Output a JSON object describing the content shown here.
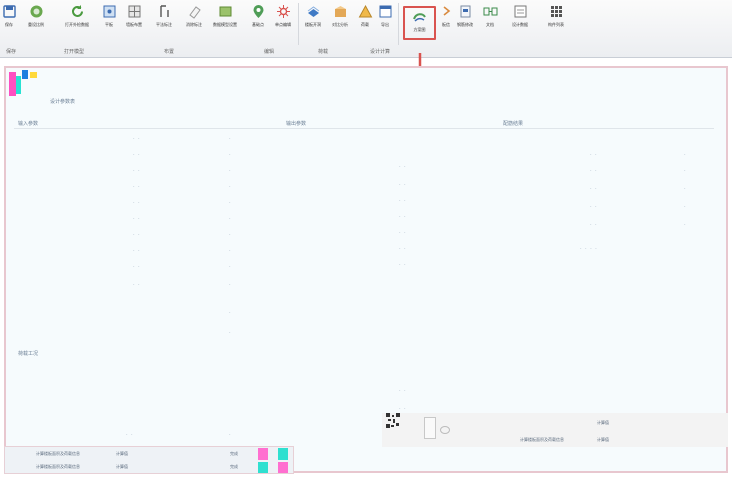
{
  "toolbar": {
    "buttons": [
      {
        "label": "保存",
        "icon": "save-icon"
      },
      {
        "label": "重设比例",
        "icon": "reset-icon"
      },
      {
        "label": "打开外检数据",
        "icon": "refresh-open-icon"
      },
      {
        "label": "平板",
        "icon": "panel-icon"
      },
      {
        "label": "墙板布置",
        "icon": "wall-panel-icon"
      },
      {
        "label": "平法标注",
        "icon": "annotation-icon"
      },
      {
        "label": "消除标注",
        "icon": "erase-icon"
      },
      {
        "label": "数据模型设置",
        "icon": "model-settings-icon"
      },
      {
        "label": "基础点",
        "icon": "map-pin-icon"
      },
      {
        "label": "单点编辑",
        "icon": "star-point-icon"
      },
      {
        "label": "楼板开洞",
        "icon": "slab-hole-icon"
      },
      {
        "label": "对比分析",
        "icon": "compare-icon"
      },
      {
        "label": "荷载",
        "icon": "load-icon"
      },
      {
        "label": "导出",
        "icon": "export-icon"
      },
      {
        "label": "方案图",
        "icon": "scheme-icon"
      },
      {
        "label": "板信",
        "icon": "slab-info-icon"
      },
      {
        "label": "钢筋修改",
        "icon": "rebar-edit-icon"
      },
      {
        "label": "文档",
        "icon": "doc-icon"
      },
      {
        "label": "设计数据",
        "icon": "design-data-icon"
      },
      {
        "label": "构件列表",
        "icon": "grid-list-icon"
      }
    ],
    "groups": [
      "保存",
      "打开模型",
      "布置",
      "编辑",
      "荷载",
      "设计计算"
    ]
  },
  "main": {
    "app_title": "",
    "section_top": "设计参数表",
    "col_headers": [
      "输入参数",
      "输出参数",
      "配筋结果"
    ],
    "section_bottom": "荷载工况",
    "table_left_rows": [
      {
        "name": "计算楼板面积及荷载信息",
        "val": "计算值",
        "status": "完成"
      },
      {
        "name": "计算楼板面积及荷载信息",
        "val": "计算值",
        "status": "完成"
      }
    ],
    "table_right_rows": [
      {
        "name": "",
        "val": "计算值"
      },
      {
        "name": "计算楼板面积及荷载信息",
        "val": "计算值"
      }
    ],
    "accent": "#d9534f"
  }
}
